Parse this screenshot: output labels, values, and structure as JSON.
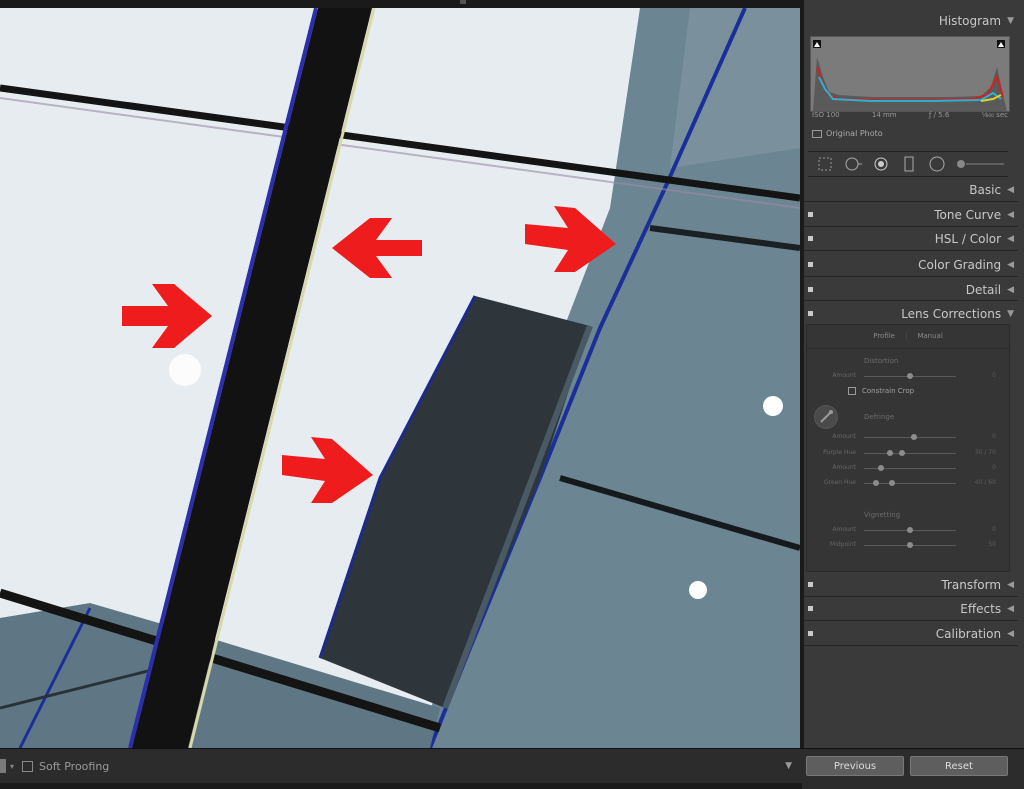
{
  "panel": {
    "histogram": {
      "title": "Histogram",
      "iso": "ISO 100",
      "focal": "14 mm",
      "aperture": "ƒ / 5.6",
      "shutter": "¹⁄₈₀₀ sec",
      "original_photo": "Original Photo"
    },
    "sections": {
      "basic": "Basic",
      "tone_curve": "Tone Curve",
      "hsl_color": "HSL / Color",
      "color_grading": "Color Grading",
      "detail": "Detail",
      "lens_corrections": "Lens Corrections",
      "transform": "Transform",
      "effects": "Effects",
      "calibration": "Calibration"
    },
    "lens": {
      "tab_profile": "Profile",
      "tab_manual": "Manual",
      "distortion": "Distortion",
      "distortion_amount_label": "Amount",
      "distortion_amount_value": "0",
      "constrain_crop": "Constrain Crop",
      "defringe": "Defringe",
      "purple_amount_label": "Amount",
      "purple_amount_value": "0",
      "purple_hue_label": "Purple Hue",
      "purple_hue_value": "30 / 70",
      "green_amount_label": "Amount",
      "green_amount_value": "0",
      "green_hue_label": "Green Hue",
      "green_hue_value": "40 / 60",
      "vignetting": "Vignetting",
      "vig_amount_label": "Amount",
      "vig_amount_value": "0",
      "vig_midpoint_label": "Midpoint",
      "vig_midpoint_value": "50"
    },
    "buttons": {
      "previous": "Previous",
      "reset": "Reset"
    }
  },
  "toolbar": {
    "soft_proofing": "Soft Proofing"
  },
  "colors": {
    "arrow": "#ee1c1c",
    "panel_bg": "#3a3a3a",
    "sky": "#e9eef2",
    "glass": "#6a8290"
  }
}
